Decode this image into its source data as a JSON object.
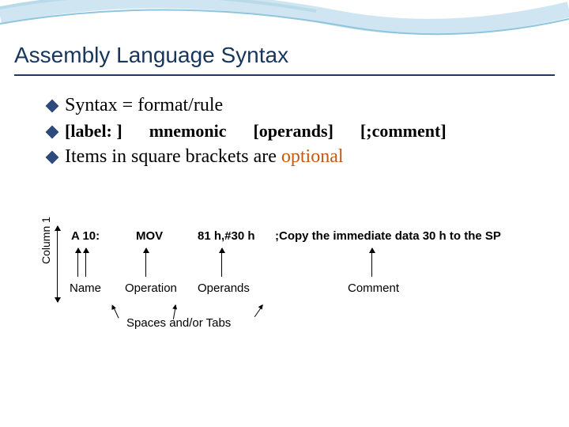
{
  "title": "Assembly Language Syntax",
  "bullets": {
    "b1": "Syntax = format/rule",
    "b2_label": "[label: ]",
    "b2_mnemonic": "mnemonic",
    "b2_operands": "[operands]",
    "b2_comment": "[;comment]",
    "b3_prefix": "Items in square brackets are ",
    "b3_optional": "optional"
  },
  "diagram": {
    "col1": "Column 1",
    "row1": {
      "label": "A 10:",
      "opn": "MOV",
      "opr": "81 h,#30 h",
      "cmt": ";Copy the immediate data 30 h to the SP"
    },
    "row2": {
      "name": "Name",
      "opn": "Operation",
      "opr": "Operands",
      "cmt": "Comment"
    },
    "spaces": "Spaces and/or Tabs"
  }
}
